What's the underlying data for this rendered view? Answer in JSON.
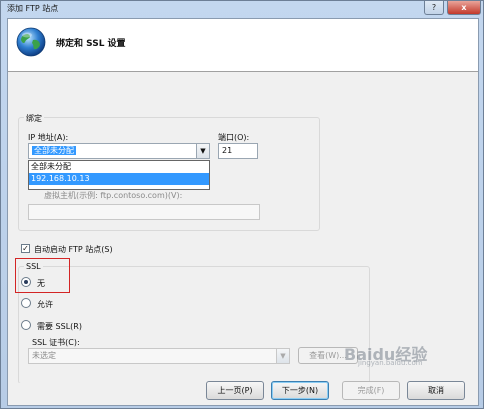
{
  "window": {
    "title": "添加 FTP 站点",
    "help_label": "?",
    "close_label": "x"
  },
  "header": {
    "title": "绑定和 SSL 设置"
  },
  "binding": {
    "group_label": "绑定",
    "ip_label": "IP 地址(A):",
    "ip_value": "全部未分配",
    "ip_options": [
      "全部未分配",
      "192.168.10.13"
    ],
    "ip_highlighted": "192.168.10.13",
    "port_label": "端口(O):",
    "port_value": "21",
    "vhost_label": "虚拟主机(示例: ftp.contoso.com)(V):",
    "vhost_value": ""
  },
  "autostart": {
    "label": "自动启动 FTP 站点(S)",
    "checked": true
  },
  "ssl": {
    "group_label": "SSL",
    "options": [
      {
        "label": "无",
        "selected": true
      },
      {
        "label": "允许",
        "selected": false
      },
      {
        "label": "需要 SSL(R)",
        "selected": false
      }
    ],
    "cert_label": "SSL 证书(C):",
    "cert_value": "未选定",
    "view_label": "查看(W)..."
  },
  "footer": {
    "prev_label": "上一页(P)",
    "next_label": "下一步(N)",
    "finish_label": "完成(F)",
    "cancel_label": "取消"
  },
  "watermark": {
    "logo": "Baidu经验",
    "url": "jingyan.baidu.com"
  }
}
